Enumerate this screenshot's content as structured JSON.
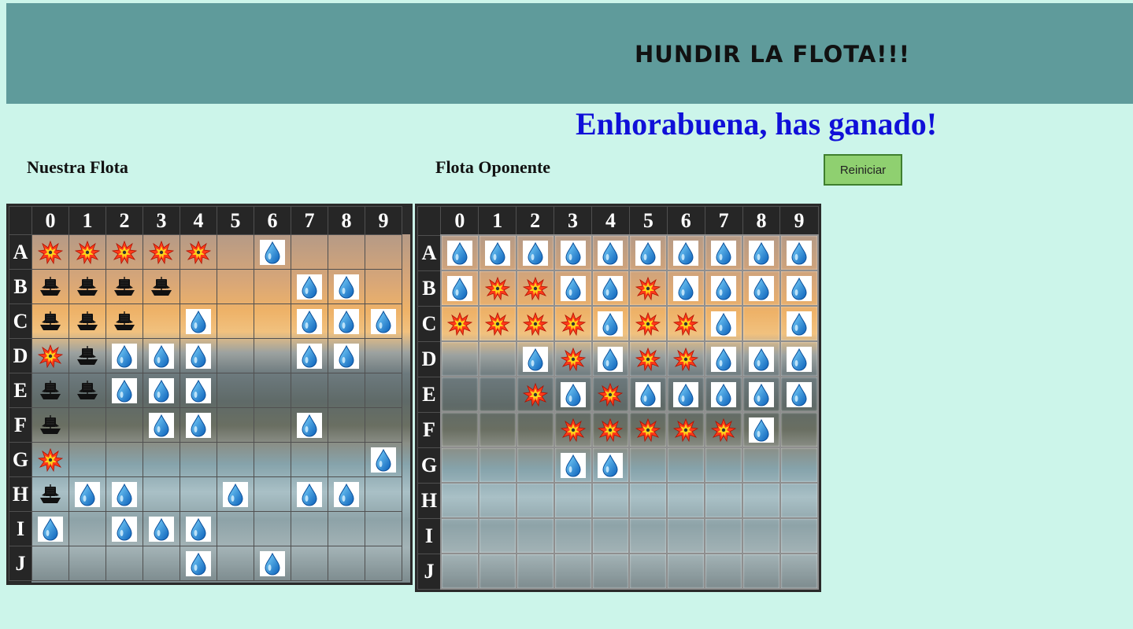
{
  "header": {
    "title": "HUNDIR LA FLOTA!!!"
  },
  "status": {
    "message": "Enhorabuena, has ganado!"
  },
  "labels": {
    "own_fleet": "Nuestra Flota",
    "opponent_fleet": "Flota Oponente"
  },
  "controls": {
    "reset_label": "Reiniciar"
  },
  "columns": [
    "0",
    "1",
    "2",
    "3",
    "4",
    "5",
    "6",
    "7",
    "8",
    "9"
  ],
  "rows": [
    "A",
    "B",
    "C",
    "D",
    "E",
    "F",
    "G",
    "H",
    "I",
    "J"
  ],
  "legend": {
    "W": "water-miss (drop icon)",
    "X": "hit (explosion icon)",
    "S": "ship (ship icon)",
    "": "unexplored"
  },
  "colors": {
    "background": "#ccf5ea",
    "header": "#5f9b9b",
    "win_message": "#1010d8",
    "button": "#8fd070",
    "board_frame": "#262626"
  },
  "own_board": [
    [
      "X",
      "X",
      "X",
      "X",
      "X",
      "",
      "W",
      "",
      "",
      ""
    ],
    [
      "S",
      "S",
      "S",
      "S",
      "",
      "",
      "",
      "W",
      "W",
      ""
    ],
    [
      "S",
      "S",
      "S",
      "",
      "W",
      "",
      "",
      "W",
      "W",
      "W"
    ],
    [
      "X",
      "S",
      "W",
      "W",
      "W",
      "",
      "",
      "W",
      "W",
      ""
    ],
    [
      "S",
      "S",
      "W",
      "W",
      "W",
      "",
      "",
      "",
      "",
      ""
    ],
    [
      "S",
      "",
      "",
      "W",
      "W",
      "",
      "",
      "W",
      "",
      ""
    ],
    [
      "X",
      "",
      "",
      "",
      "",
      "",
      "",
      "",
      "",
      "W"
    ],
    [
      "S",
      "W",
      "W",
      "",
      "",
      "W",
      "",
      "W",
      "W",
      ""
    ],
    [
      "W",
      "",
      "W",
      "W",
      "W",
      "",
      "",
      "",
      "",
      ""
    ],
    [
      "",
      "",
      "",
      "",
      "W",
      "",
      "W",
      "",
      "",
      ""
    ]
  ],
  "opponent_board": [
    [
      "W",
      "W",
      "W",
      "W",
      "W",
      "W",
      "W",
      "W",
      "W",
      "W"
    ],
    [
      "W",
      "X",
      "X",
      "W",
      "W",
      "X",
      "W",
      "W",
      "W",
      "W"
    ],
    [
      "X",
      "X",
      "X",
      "X",
      "W",
      "X",
      "X",
      "W",
      "",
      "W"
    ],
    [
      "",
      "",
      "W",
      "X",
      "W",
      "X",
      "X",
      "W",
      "W",
      "W"
    ],
    [
      "",
      "",
      "X",
      "W",
      "X",
      "W",
      "W",
      "W",
      "W",
      "W"
    ],
    [
      "",
      "",
      "",
      "X",
      "X",
      "X",
      "X",
      "X",
      "W",
      ""
    ],
    [
      "",
      "",
      "",
      "W",
      "W",
      "",
      "",
      "",
      "",
      ""
    ],
    [
      "",
      "",
      "",
      "",
      "",
      "",
      "",
      "",
      "",
      ""
    ],
    [
      "",
      "",
      "",
      "",
      "",
      "",
      "",
      "",
      "",
      ""
    ],
    [
      "",
      "",
      "",
      "",
      "",
      "",
      "",
      "",
      "",
      ""
    ]
  ]
}
